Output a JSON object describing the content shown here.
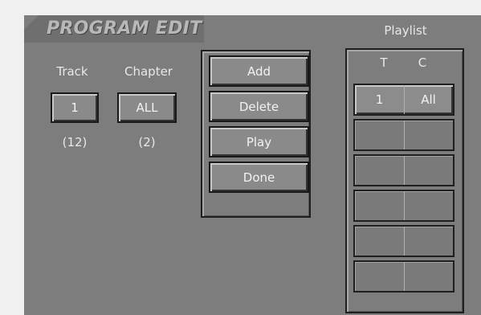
{
  "screen": {
    "title": "PROGRAM EDIT"
  },
  "selector": {
    "track_label": "Track",
    "chapter_label": "Chapter",
    "track_value": "1",
    "chapter_value": "ALL",
    "track_count": "(12)",
    "chapter_count": "(2)"
  },
  "actions": {
    "add_label": "Add",
    "delete_label": "Delete",
    "play_label": "Play",
    "done_label": "Done"
  },
  "playlist": {
    "title": "Playlist",
    "col_t": "T",
    "col_c": "C",
    "rows": [
      {
        "t": "1",
        "c": "All"
      },
      {
        "t": "",
        "c": ""
      },
      {
        "t": "",
        "c": ""
      },
      {
        "t": "",
        "c": ""
      },
      {
        "t": "",
        "c": ""
      },
      {
        "t": "",
        "c": ""
      }
    ]
  }
}
